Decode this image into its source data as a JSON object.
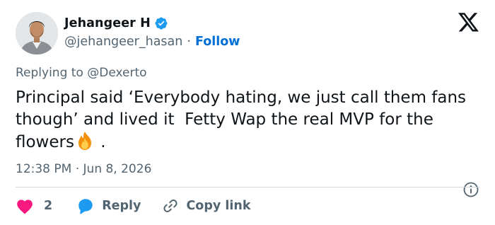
{
  "author": {
    "display_name": "Jehangeer H",
    "handle": "@jehangeer_hasan",
    "separator": "·",
    "follow_label": "Follow",
    "verified": true
  },
  "platform_logo": "x-logo-icon",
  "reply_to": "Replying to @Dexerto",
  "tweet": {
    "text_main": "Principal said ‘Everybody hating, we just call them fans though’ and lived it  Fetty Wap the real MVP for the flowers",
    "emoji": "fire-emoji-icon",
    "text_tail": " ."
  },
  "timestamp": "12:38 PM · Jun 8, 2026",
  "actions": {
    "like_count": "2",
    "reply_label": "Reply",
    "copy_link_label": "Copy link"
  },
  "colors": {
    "accent": "#1d9bf0",
    "follow": "#006fd6",
    "like": "#f91880",
    "secondary_text": "#536471",
    "text": "#0f1419",
    "divider": "#cfd9de"
  }
}
